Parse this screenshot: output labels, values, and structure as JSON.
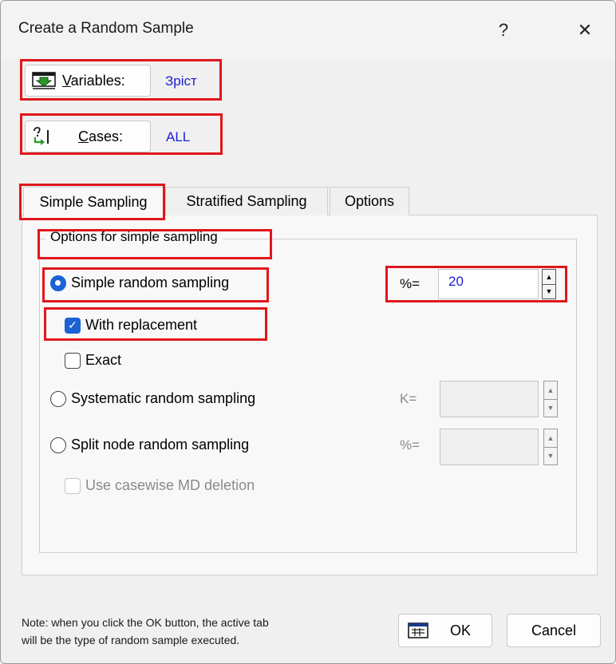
{
  "window": {
    "title": "Create a Random Sample",
    "help_glyph": "?",
    "close_glyph": "✕"
  },
  "variables": {
    "label_prefix": "V",
    "label_rest": "ariables:",
    "value": "Зріст",
    "icon": "variables-icon"
  },
  "cases": {
    "label_prefix": "C",
    "label_rest": "ases:",
    "value": "ALL",
    "icon": "cases-icon"
  },
  "tabs": [
    {
      "label": "Simple Sampling",
      "active": true
    },
    {
      "label": "Stratified Sampling",
      "active": false
    },
    {
      "label": "Options",
      "active": false
    }
  ],
  "group": {
    "title": "Options for simple sampling",
    "simple": {
      "label": "Simple random sampling",
      "selected": true
    },
    "percent": {
      "label": "%=",
      "value": "20"
    },
    "with_replacement": {
      "label": "With replacement",
      "checked": true
    },
    "exact": {
      "label": "Exact",
      "checked": false
    },
    "systematic": {
      "label": "Systematic random sampling",
      "selected": false,
      "field_label": "K=",
      "value": ""
    },
    "split": {
      "label": "Split node random sampling",
      "selected": false,
      "field_label": "%=",
      "value": ""
    },
    "casewise": {
      "label": "Use casewise MD deletion",
      "checked": false,
      "enabled": false
    }
  },
  "footer": {
    "note_line1": "Note: when you click the OK button, the active tab",
    "note_line2": "will be the type of random sample executed.",
    "ok_label": "OK",
    "cancel_label": "Cancel"
  },
  "colors": {
    "highlight": "#e0161b",
    "accent": "#1a62d6",
    "value_text": "#1c1cd4"
  }
}
